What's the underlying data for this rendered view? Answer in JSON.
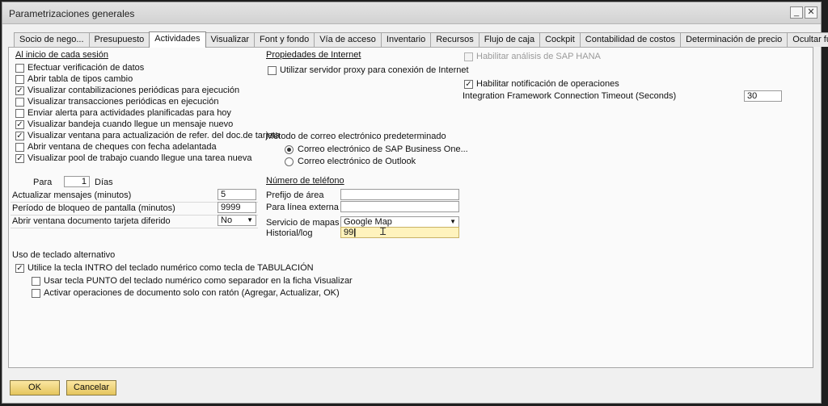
{
  "window": {
    "title": "Parametrizaciones generales"
  },
  "tabs": [
    "Socio de nego...",
    "Presupuesto",
    "Actividades",
    "Visualizar",
    "Font y fondo",
    "Vía de acceso",
    "Inventario",
    "Recursos",
    "Flujo de caja",
    "Cockpit",
    "Contabilidad de costos",
    "Determinación de precio",
    "Ocultar funciones"
  ],
  "left": {
    "section_title": "Al inicio de cada sesión",
    "checkboxes": [
      {
        "label": "Efectuar verificación de datos",
        "checked": false
      },
      {
        "label": "Abrir tabla de tipos cambio",
        "checked": false
      },
      {
        "label": "Visualizar contabilizaciones periódicas para ejecución",
        "checked": true
      },
      {
        "label": "Visualizar transacciones periódicas en ejecución",
        "checked": false
      },
      {
        "label": "Enviar alerta para actividades planificadas para hoy",
        "checked": false
      },
      {
        "label": "Visualizar bandeja cuando llegue un mensaje nuevo",
        "checked": true
      },
      {
        "label": "Visualizar ventana para actualización de refer. del doc.de tarjeta",
        "checked": true
      },
      {
        "label": "Abrir ventana de cheques con fecha adelantada",
        "checked": false
      },
      {
        "label": "Visualizar pool de trabajo cuando llegue una tarea nueva",
        "checked": true
      }
    ],
    "para_label": "Para",
    "para_value": "1",
    "dias_label": "Días",
    "fields": [
      {
        "label": "Actualizar mensajes (minutos)",
        "value": "5"
      },
      {
        "label": "Período de bloqueo de pantalla (minutos)",
        "value": "9999"
      },
      {
        "label": "Abrir ventana documento tarjeta diferido",
        "value": "No"
      }
    ]
  },
  "middle": {
    "internet_title": "Propiedades de Internet",
    "proxy_label": "Utilizar servidor proxy para conexión de Internet",
    "proxy_checked": false,
    "email_title": "Método de correo electrónico predeterminado",
    "email_options": [
      {
        "label": "Correo electrónico de SAP Business One...",
        "selected": true
      },
      {
        "label": "Correo electrónico de Outlook",
        "selected": false
      }
    ],
    "phone_title": "Número de teléfono",
    "phone_fields": [
      {
        "label": "Prefijo de área",
        "value": ""
      },
      {
        "label": "Para línea externa",
        "value": ""
      }
    ],
    "maps_label": "Servicio de mapas",
    "maps_value": "Google Map",
    "history_label": "Historial/log",
    "history_value": "99"
  },
  "right": {
    "hana_label": "Habilitar análisis de SAP HANA",
    "notif_label": "Habilitar notificación de operaciones",
    "notif_checked": true,
    "timeout_label": "Integration Framework Connection Timeout (Seconds)",
    "timeout_value": "30"
  },
  "keyboard": {
    "title": "Uso de teclado alternativo",
    "options": [
      {
        "label": "Utilice la tecla INTRO del teclado numérico como tecla de TABULACIÓN",
        "checked": true
      },
      {
        "label": "Usar tecla PUNTO del teclado numérico como separador en la ficha Visualizar",
        "checked": false
      },
      {
        "label": "Activar operaciones de documento solo con ratón (Agregar, Actualizar, OK)",
        "checked": false
      }
    ]
  },
  "buttons": {
    "ok": "OK",
    "cancel": "Cancelar"
  }
}
